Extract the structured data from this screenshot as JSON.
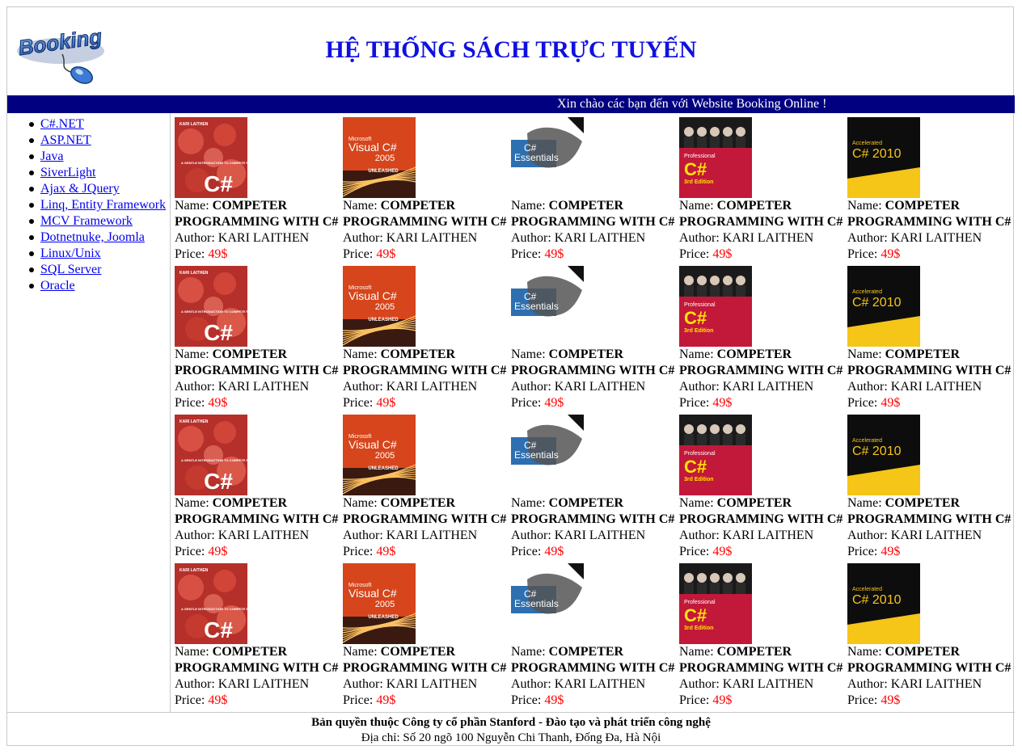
{
  "header": {
    "logo_text": "Booking",
    "title": "HỆ THỐNG SÁCH TRỰC TUYẾN"
  },
  "marquee": {
    "text": "Xin chào các bạn đến với Website Booking Online !",
    "bg_color": "#000080"
  },
  "sidebar": {
    "items": [
      {
        "label": "C#.NET"
      },
      {
        "label": "ASP.NET"
      },
      {
        "label": "Java"
      },
      {
        "label": "SiverLight"
      },
      {
        "label": "Ajax & JQuery"
      },
      {
        "label": "Linq, Entity Framework"
      },
      {
        "label": "MCV Framework"
      },
      {
        "label": "Dotnetnuke, Joomla"
      },
      {
        "label": "Linux/Unix"
      },
      {
        "label": "SQL Server"
      },
      {
        "label": "Oracle"
      }
    ]
  },
  "book_labels": {
    "name": "Name:",
    "author": "Author:",
    "price": "Price:"
  },
  "book_covers": [
    {
      "style": "red-flowers",
      "badge": "KARI LAITHEN",
      "caption": "A GENTLE INTRODUCTION TO COMPETE PROGRAMMING WITH",
      "big": "C#"
    },
    {
      "style": "visual-cs",
      "brand": "Microsoft",
      "line1": "Visual C#",
      "line2": "2005",
      "line3": "UNLEASHED"
    },
    {
      "style": "essentials",
      "line1": "C#",
      "line2": "Essentials"
    },
    {
      "style": "professional",
      "line1": "Professional",
      "big": "C#",
      "line2": "3rd Edition"
    },
    {
      "style": "accelerated",
      "line1": "Accelerated",
      "big": "C# 2010"
    }
  ],
  "books": [
    {
      "name": "COMPETER PROGRAMMING WITH C#",
      "author": "KARI LAITHEN",
      "price": "49$",
      "cover": 0
    },
    {
      "name": "COMPETER PROGRAMMING WITH C#",
      "author": "KARI LAITHEN",
      "price": "49$",
      "cover": 1
    },
    {
      "name": "COMPETER PROGRAMMING WITH C#",
      "author": "KARI LAITHEN",
      "price": "49$",
      "cover": 2
    },
    {
      "name": "COMPETER PROGRAMMING WITH C#",
      "author": "KARI LAITHEN",
      "price": "49$",
      "cover": 3
    },
    {
      "name": "COMPETER PROGRAMMING WITH C#",
      "author": "KARI LAITHEN",
      "price": "49$",
      "cover": 4
    },
    {
      "name": "COMPETER PROGRAMMING WITH C#",
      "author": "KARI LAITHEN",
      "price": "49$",
      "cover": 0
    },
    {
      "name": "COMPETER PROGRAMMING WITH C#",
      "author": "KARI LAITHEN",
      "price": "49$",
      "cover": 1
    },
    {
      "name": "COMPETER PROGRAMMING WITH C#",
      "author": "KARI LAITHEN",
      "price": "49$",
      "cover": 2
    },
    {
      "name": "COMPETER PROGRAMMING WITH C#",
      "author": "KARI LAITHEN",
      "price": "49$",
      "cover": 3
    },
    {
      "name": "COMPETER PROGRAMMING WITH C#",
      "author": "KARI LAITHEN",
      "price": "49$",
      "cover": 4
    },
    {
      "name": "COMPETER PROGRAMMING WITH C#",
      "author": "KARI LAITHEN",
      "price": "49$",
      "cover": 0
    },
    {
      "name": "COMPETER PROGRAMMING WITH C#",
      "author": "KARI LAITHEN",
      "price": "49$",
      "cover": 1
    },
    {
      "name": "COMPETER PROGRAMMING WITH C#",
      "author": "KARI LAITHEN",
      "price": "49$",
      "cover": 2
    },
    {
      "name": "COMPETER PROGRAMMING WITH C#",
      "author": "KARI LAITHEN",
      "price": "49$",
      "cover": 3
    },
    {
      "name": "COMPETER PROGRAMMING WITH C#",
      "author": "KARI LAITHEN",
      "price": "49$",
      "cover": 4
    },
    {
      "name": "COMPETER PROGRAMMING WITH C#",
      "author": "KARI LAITHEN",
      "price": "49$",
      "cover": 0
    },
    {
      "name": "COMPETER PROGRAMMING WITH C#",
      "author": "KARI LAITHEN",
      "price": "49$",
      "cover": 1
    },
    {
      "name": "COMPETER PROGRAMMING WITH C#",
      "author": "KARI LAITHEN",
      "price": "49$",
      "cover": 2
    },
    {
      "name": "COMPETER PROGRAMMING WITH C#",
      "author": "KARI LAITHEN",
      "price": "49$",
      "cover": 3
    },
    {
      "name": "COMPETER PROGRAMMING WITH C#",
      "author": "KARI LAITHEN",
      "price": "49$",
      "cover": 4
    }
  ],
  "footer": {
    "copyright": "Bản quyền thuộc Công ty cổ phần Stanford - Đào tạo và phát triển công nghệ",
    "address": "Địa chỉ: Số 20 ngõ 100 Nguyễn Chi Thanh, Đống Đa, Hà Nội"
  },
  "colors": {
    "title": "#1010e0",
    "link": "#0000ee",
    "price": "#ff0000"
  }
}
